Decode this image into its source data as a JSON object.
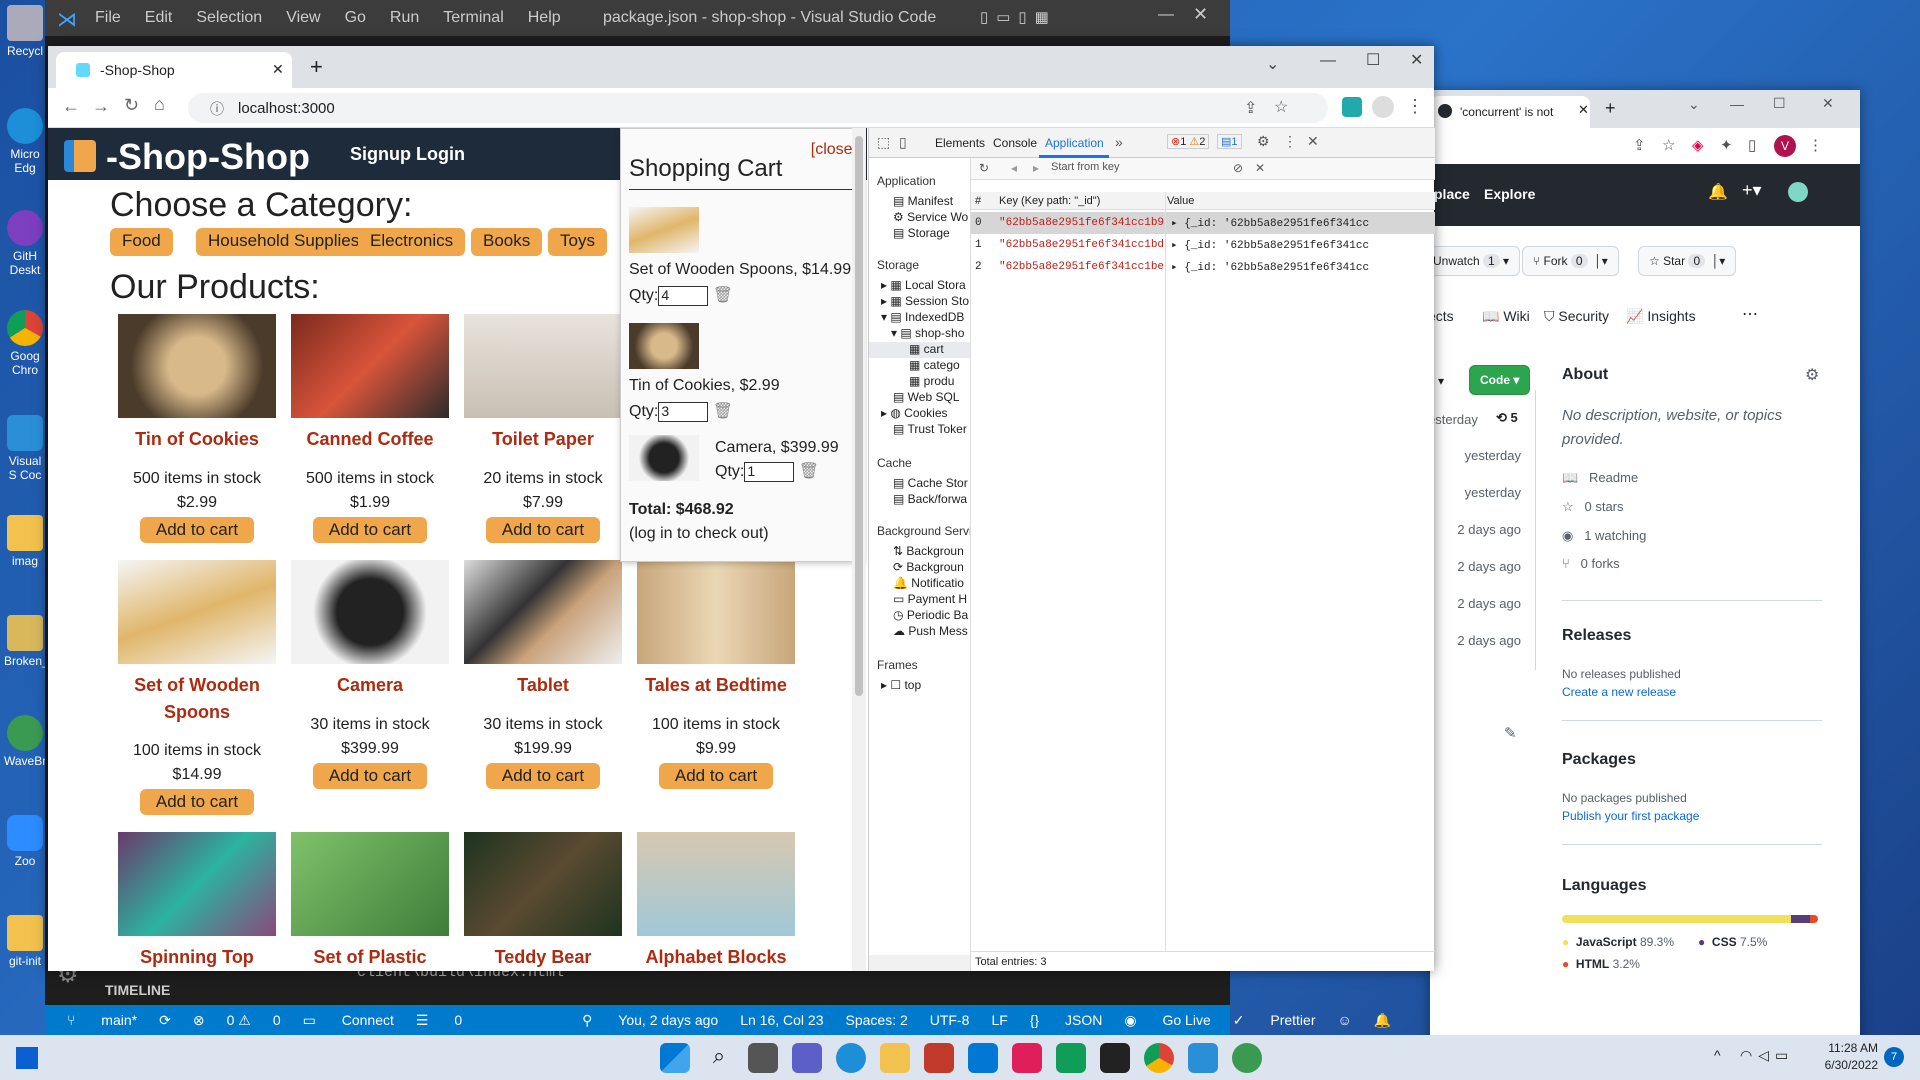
{
  "desktop": {
    "icons": [
      "Recycl",
      "Micro Edg",
      "GitH Deskt",
      "Goog Chro",
      "Visual S Coc",
      "imag",
      "Broken_",
      "WaveBr",
      "Zoo",
      "git-init"
    ]
  },
  "vscode": {
    "title": "package.json - shop-shop - Visual Studio Code",
    "menu": [
      "File",
      "Edit",
      "Selection",
      "View",
      "Go",
      "Run",
      "Terminal",
      "Help"
    ],
    "timeline": "TIMELINE",
    "terminal_line": "client\\build\\index.html",
    "status": {
      "branch": "main*",
      "errors": "0",
      "warnings": "0",
      "connect": "Connect",
      "ports": "0",
      "blame": "You, 2 days ago",
      "position": "Ln 16, Col 23",
      "spaces": "Spaces: 2",
      "encoding": "UTF-8",
      "eol": "LF",
      "language": "JSON",
      "golive": "Go Live",
      "prettier": "Prettier"
    }
  },
  "browser": {
    "tab_title": "-Shop-Shop",
    "url": "localhost:3000"
  },
  "shop": {
    "brand": "-Shop-Shop",
    "signup": "Signup",
    "login": "Login",
    "category_heading": "Choose a Category:",
    "categories": [
      "Food",
      "Household Supplies",
      "Electronics",
      "Books",
      "Toys"
    ],
    "products_heading": "Our Products:",
    "add_label": "Add to cart",
    "products": [
      {
        "name": "Tin of Cookies",
        "stock": "500 items in stock",
        "price": "$2.99"
      },
      {
        "name": "Canned Coffee",
        "stock": "500 items in stock",
        "price": "$1.99"
      },
      {
        "name": "Toilet Paper",
        "stock": "20 items in stock",
        "price": "$7.99"
      },
      {
        "name": "Set of Wooden Spoons",
        "stock": "100 items in stock",
        "price": "$14.99"
      },
      {
        "name": "Camera",
        "stock": "30 items in stock",
        "price": "$399.99"
      },
      {
        "name": "Tablet",
        "stock": "30 items in stock",
        "price": "$199.99"
      },
      {
        "name": "Tales at Bedtime",
        "stock": "100 items in stock",
        "price": "$9.99"
      },
      {
        "name": "Spinning Top"
      },
      {
        "name": "Set of Plastic"
      },
      {
        "name": "Teddy Bear"
      },
      {
        "name": "Alphabet Blocks"
      }
    ]
  },
  "cart": {
    "close": "[close]",
    "title": "Shopping Cart",
    "qty_label": "Qty:",
    "items": [
      {
        "name": "Set of Wooden Spoons, $14.99",
        "qty": "4"
      },
      {
        "name": "Tin of Cookies, $2.99",
        "qty": "3"
      },
      {
        "name": "Camera, $399.99",
        "qty": "1"
      }
    ],
    "total": "Total: $468.92",
    "note": "(log in to check out)"
  },
  "devtools": {
    "tabs": [
      "Elements",
      "Console",
      "Application"
    ],
    "errors": "1",
    "warnings": "2",
    "messages": "1",
    "sidebar": {
      "application_header": "Application",
      "application_items": [
        "Manifest",
        "Service Wo",
        "Storage"
      ],
      "storage_header": "Storage",
      "storage_items": [
        "Local Stora",
        "Session Sto",
        "IndexedDB",
        "shop-sho",
        "cart",
        "catego",
        "produ",
        "Web SQL",
        "Cookies",
        "Trust Toker"
      ],
      "cache_header": "Cache",
      "cache_items": [
        "Cache Stor",
        "Back/forwa"
      ],
      "bg_header": "Background Servi",
      "bg_items": [
        "Backgroun",
        "Backgroun",
        "Notificatio",
        "Payment H",
        "Periodic Ba",
        "Push Mess"
      ],
      "frames_header": "Frames",
      "frames_items": [
        "top"
      ]
    },
    "filter_placeholder": "Start from key",
    "columns": [
      "#",
      "Key (Key path: \"_id\")",
      "Value"
    ],
    "rows": [
      {
        "index": "0",
        "key": "\"62bb5a8e2951fe6f341cc1b9\"",
        "value": "{_id: '62bb5a8e2951fe6f341cc"
      },
      {
        "index": "1",
        "key": "\"62bb5a8e2951fe6f341cc1bd\"",
        "value": "{_id: '62bb5a8e2951fe6f341cc"
      },
      {
        "index": "2",
        "key": "\"62bb5a8e2951fe6f341cc1be\"",
        "value": "{_id: '62bb5a8e2951fe6f341cc"
      }
    ],
    "footer": "Total entries: 3"
  },
  "github": {
    "tab_title": "'concurrent' is not",
    "nav": [
      "place",
      "Explore"
    ],
    "unwatch": "Unwatch",
    "unwatch_count": "1",
    "fork": "Fork",
    "fork_count": "0",
    "star": "Star",
    "star_count": "0",
    "repo_tabs": [
      "ects",
      "Wiki",
      "Security",
      "Insights"
    ],
    "code_button": "Code",
    "commit_time": "esterday",
    "commit_count": "5",
    "file_times": [
      "yesterday",
      "yesterday",
      "2 days ago",
      "2 days ago",
      "2 days ago",
      "2 days ago"
    ],
    "about_title": "About",
    "about_desc": "No description, website, or topics provided.",
    "about_items": [
      "Readme",
      "0 stars",
      "1 watching",
      "0 forks"
    ],
    "releases_title": "Releases",
    "releases_text": "No releases published",
    "releases_link": "Create a new release",
    "packages_title": "Packages",
    "packages_text": "No packages published",
    "packages_link": "Publish your first package",
    "languages_title": "Languages",
    "languages": [
      {
        "name": "JavaScript",
        "percent": "89.3%",
        "share": 89.3,
        "color": "#f1e05a"
      },
      {
        "name": "CSS",
        "percent": "7.5%",
        "share": 7.5,
        "color": "#563d7c"
      },
      {
        "name": "HTML",
        "percent": "3.2%",
        "share": 3.2,
        "color": "#e34c26"
      }
    ]
  },
  "taskbar": {
    "time": "11:28 AM",
    "date": "6/30/2022",
    "notifications": "7"
  }
}
